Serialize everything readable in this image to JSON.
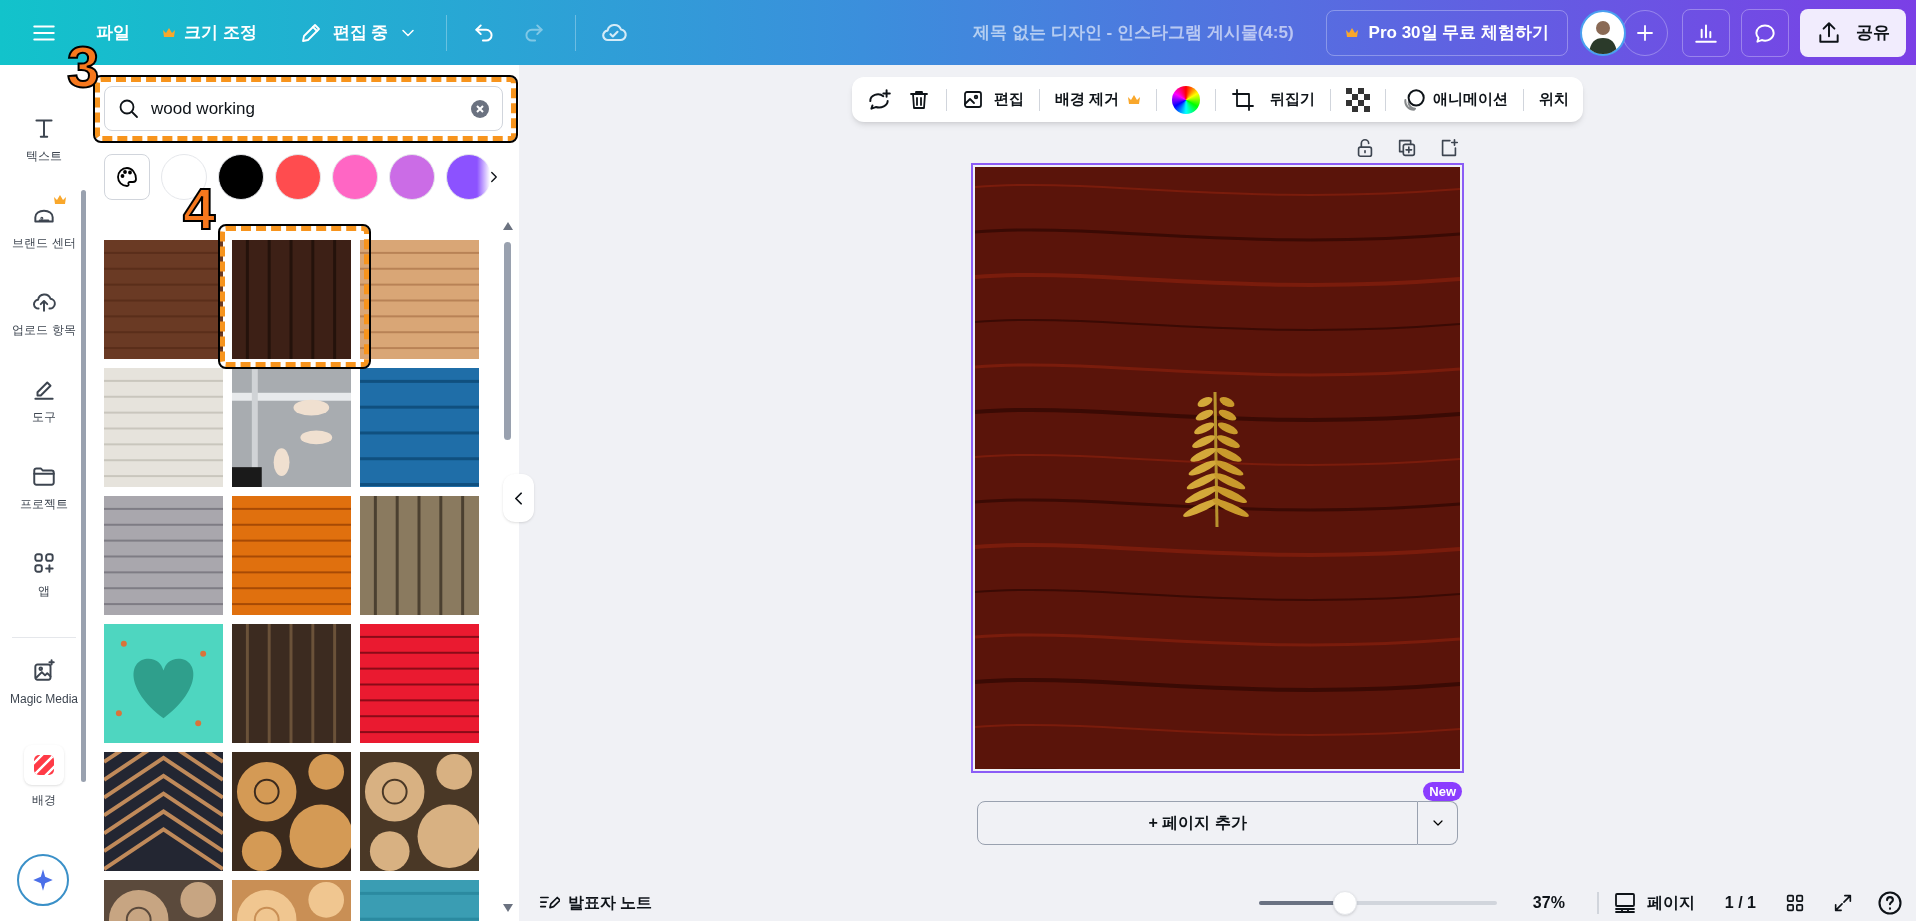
{
  "header": {
    "file": "파일",
    "resize": "크기 조정",
    "mode": "편집 중",
    "undo": {
      "disabled": false
    },
    "redo": {
      "disabled": true
    },
    "title": "제목 없는 디자인 - 인스타그램 게시물(4:5)",
    "pro": "Pro 30일 무료 체험하기",
    "share": "공유"
  },
  "rail": {
    "items": [
      {
        "kind": "text",
        "label": "텍스트"
      },
      {
        "kind": "brand",
        "label": "브랜드 센터"
      },
      {
        "kind": "upload",
        "label": "업로드 항목"
      },
      {
        "kind": "tools",
        "label": "도구"
      },
      {
        "kind": "projects",
        "label": "프로젝트"
      },
      {
        "kind": "apps",
        "label": "앱"
      },
      {
        "kind": "magic",
        "label": "Magic Media"
      },
      {
        "kind": "background",
        "label": "배경"
      }
    ]
  },
  "search": {
    "value": "wood working"
  },
  "swatches": [
    {
      "color": "#ffffff"
    },
    {
      "color": "#000000"
    },
    {
      "color": "#ff4c4f"
    },
    {
      "color": "#ff66c4"
    },
    {
      "color": "#cb6ce6"
    },
    {
      "color": "#8c52ff"
    }
  ],
  "annotations": [
    {
      "label": "3"
    },
    {
      "label": "4"
    }
  ],
  "toolbar": {
    "edit": "편집",
    "remove_bg": "배경 제거",
    "flip": "뒤집기",
    "animate": "애니메이션",
    "position": "위치"
  },
  "add_page": {
    "label": "+ 페이지 추가",
    "badge": "New"
  },
  "footer": {
    "notes": "발표자 노트",
    "zoom": {
      "level": 0.36
    },
    "zoom_reading": "37%",
    "pages": "페이지",
    "page_count": "1 / 1"
  }
}
